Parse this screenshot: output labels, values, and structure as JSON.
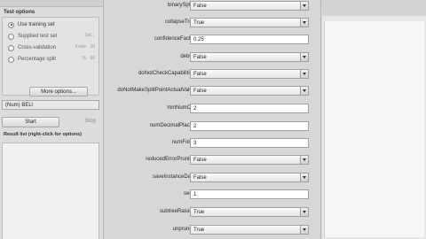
{
  "test_options": {
    "title": "Test options",
    "radios": [
      {
        "label": "Use training set",
        "selected": true
      },
      {
        "label": "Supplied test set",
        "selected": false,
        "extra": "Set..."
      },
      {
        "label": "Cross-validation",
        "selected": false,
        "extra_label": "Folds",
        "extra": "10"
      },
      {
        "label": "Percentage split",
        "selected": false,
        "extra_label": "%",
        "extra": "66"
      }
    ],
    "more_options": "More options..."
  },
  "class_attribute": "(Num) BEL\\",
  "start_label": "Start",
  "stop_label": "Stop",
  "result_list_title": "Result list (right-click for options)",
  "properties": [
    {
      "name": "binarySplits",
      "type": "combo",
      "value": "False"
    },
    {
      "name": "collapseTree",
      "type": "combo",
      "value": "True"
    },
    {
      "name": "confidenceFactor",
      "type": "text",
      "value": "0.25"
    },
    {
      "name": "debug",
      "type": "combo",
      "value": "False"
    },
    {
      "name": "doNotCheckCapabilities",
      "type": "combo",
      "value": "False"
    },
    {
      "name": "doNotMakeSplitPointActualValue",
      "type": "combo",
      "value": "False"
    },
    {
      "name": "minNumObj",
      "type": "text",
      "value": "2"
    },
    {
      "name": "numDecimalPlaces",
      "type": "text",
      "value": "2"
    },
    {
      "name": "numFolds",
      "type": "text",
      "value": "3"
    },
    {
      "name": "reducedErrorPruning",
      "type": "combo",
      "value": "False"
    },
    {
      "name": "saveInstanceData",
      "type": "combo",
      "value": "False"
    },
    {
      "name": "seed",
      "type": "text",
      "value": "1"
    },
    {
      "name": "subtreeRaising",
      "type": "combo",
      "value": "True"
    },
    {
      "name": "unpruned",
      "type": "combo",
      "value": "True"
    }
  ]
}
